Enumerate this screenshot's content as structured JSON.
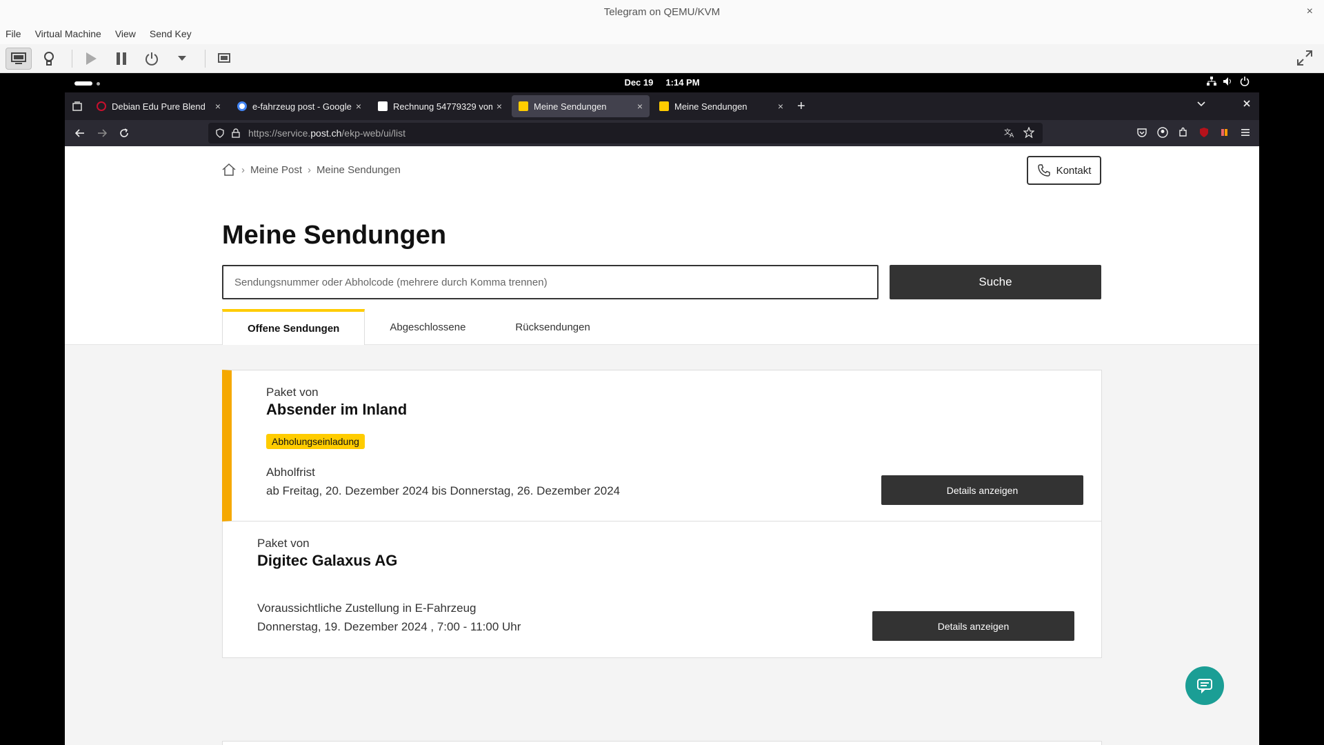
{
  "host_window": {
    "title": "Telegram on QEMU/KVM",
    "close": "×"
  },
  "host_menu": [
    "File",
    "Virtual Machine",
    "View",
    "Send Key"
  ],
  "gnome_topbar": {
    "date": "Dec 19",
    "time": "1:14 PM"
  },
  "browser": {
    "tabs": [
      {
        "title": "Debian Edu Pure Blend",
        "favicon_color": "#c8102e",
        "active": false
      },
      {
        "title": "e-fahrzeug post - Google",
        "favicon_color": "#4285f4",
        "active": false
      },
      {
        "title": "Rechnung 54779329 vom",
        "favicon_color": "#ffffff",
        "active": false
      },
      {
        "title": "Meine Sendungen",
        "favicon_color": "#fc0",
        "active": true
      },
      {
        "title": "Meine Sendungen",
        "favicon_color": "#fc0",
        "active": false
      }
    ],
    "tab_close": "×",
    "new_tab": "+",
    "url": {
      "prefix": "https://service.",
      "host": "post.ch",
      "path": "/ekp-web/ui/list"
    }
  },
  "page": {
    "breadcrumb": [
      "Meine Post",
      "Meine Sendungen"
    ],
    "kontakt_label": "Kontakt",
    "title": "Meine Sendungen",
    "search_placeholder": "Sendungsnummer oder Abholcode (mehrere durch Komma trennen)",
    "search_button": "Suche",
    "tabs": [
      "Offene Sendungen",
      "Abgeschlossene",
      "Rücksendungen"
    ],
    "shipments": [
      {
        "label": "Paket von",
        "sender": "Absender im Inland",
        "badge": "Abholungseinladung",
        "info_label": "Abholfrist",
        "info_value": "ab Freitag, 20. Dezember 2024 bis Donnerstag, 26. Dezember 2024",
        "button": "Details anzeigen"
      },
      {
        "label": "Paket von",
        "sender": "Digitec Galaxus AG",
        "info_label": "Voraussichtliche Zustellung in E-Fahrzeug",
        "info_value": "Donnerstag, 19. Dezember 2024 , 7:00 - 11:00 Uhr",
        "button": "Details anzeigen"
      }
    ]
  },
  "colors": {
    "accent_yellow": "#ffcc00",
    "accent_orange": "#f5a800",
    "dark_button": "#333333",
    "chat_fab": "#1b9e95"
  }
}
